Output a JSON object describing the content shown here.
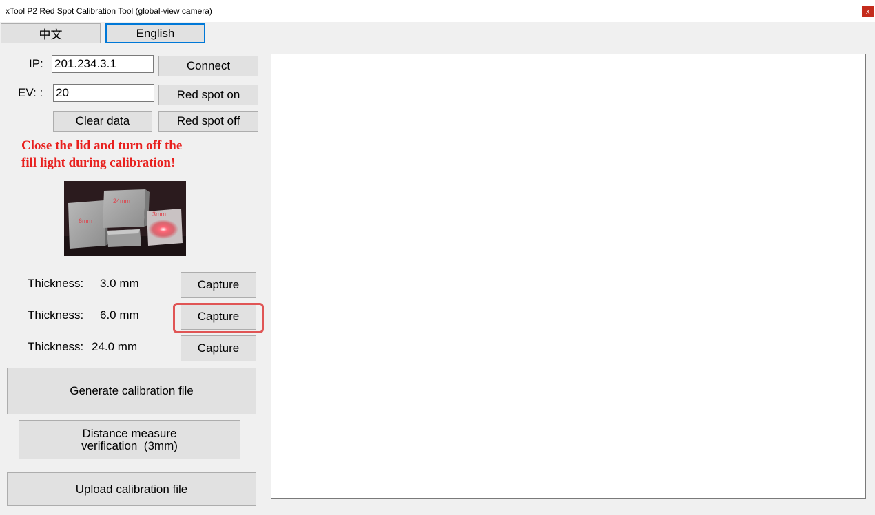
{
  "window": {
    "title": "xTool P2 Red Spot Calibration Tool (global-view camera)",
    "close_glyph": "x"
  },
  "language": {
    "chinese_label": "中文",
    "english_label": "English",
    "active": "English"
  },
  "connection": {
    "ip_label": "IP:",
    "ip_value": "201.234.3.1",
    "connect_label": "Connect",
    "ev_label": "EV: :",
    "ev_value": "20",
    "red_spot_on_label": "Red spot on",
    "clear_data_label": "Clear data",
    "red_spot_off_label": "Red spot off"
  },
  "warning": {
    "line1": "Close the lid and turn off the",
    "line2": "fill light during calibration!"
  },
  "reference_image": {
    "label_24mm": "24mm",
    "label_6mm": "6mm",
    "label_3mm": "3mm"
  },
  "thickness_rows": [
    {
      "label": "Thickness:",
      "value": "3.0 mm",
      "button": "Capture"
    },
    {
      "label": "Thickness:",
      "value": "6.0 mm",
      "button": "Capture"
    },
    {
      "label": "Thickness:",
      "value": "24.0 mm",
      "button": "Capture"
    }
  ],
  "actions": {
    "generate_label": "Generate calibration file",
    "distance_line1": "Distance measure",
    "distance_line2": "verification  (3mm)",
    "upload_label": "Upload calibration file"
  },
  "colors": {
    "warning_text": "#e8201e",
    "highlight_border": "#e05555",
    "active_border": "#0078d7",
    "close_button": "#c42b1c"
  }
}
